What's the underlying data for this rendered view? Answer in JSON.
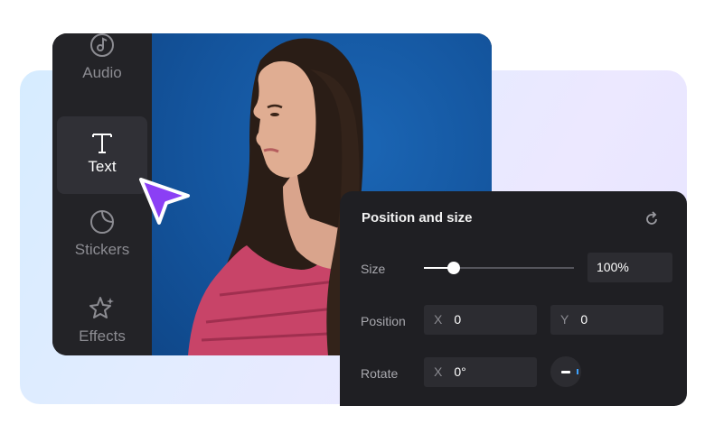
{
  "sidebar": {
    "items": [
      {
        "label": "Audio",
        "icon": "music-note-icon"
      },
      {
        "label": "Text",
        "icon": "text-t-icon",
        "active": true
      },
      {
        "label": "Stickers",
        "icon": "sticker-icon"
      },
      {
        "label": "Effects",
        "icon": "sparkle-star-icon"
      }
    ]
  },
  "panel": {
    "title": "Position and size",
    "size": {
      "label": "Size",
      "value": "100%",
      "level": 0.2
    },
    "position": {
      "label": "Position",
      "x_axis": "X",
      "x_value": "0",
      "y_axis": "Y",
      "y_value": "0"
    },
    "rotate": {
      "label": "Rotate",
      "x_axis": "X",
      "x_value": "0°"
    }
  },
  "colors": {
    "accent": "#8b3ff5",
    "panel_bg": "#1f1f23",
    "sidebar_bg": "#232327",
    "canvas_bg": "#14559e"
  }
}
